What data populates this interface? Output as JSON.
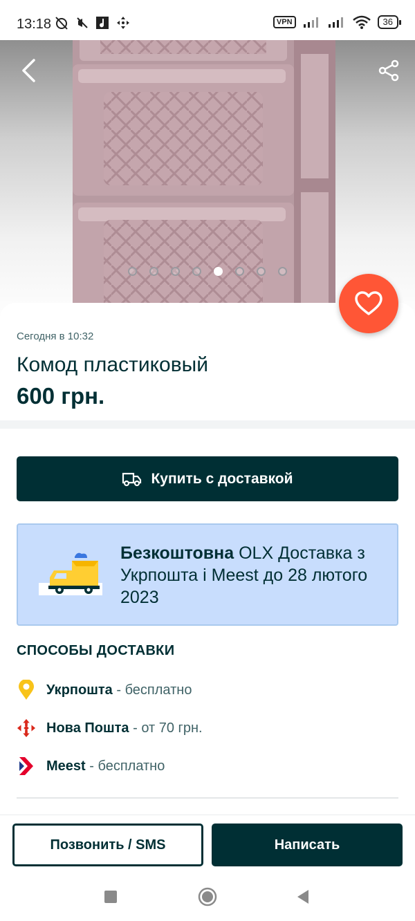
{
  "status_bar": {
    "time": "13:18",
    "vpn": "VPN",
    "battery": "36"
  },
  "gallery": {
    "image_count": 8,
    "active_index": 4
  },
  "listing": {
    "date": "Сегодня в 10:32",
    "title": "Комод пластиковый",
    "price": "600 грн."
  },
  "buy_button": {
    "label": "Купить с доставкой"
  },
  "promo": {
    "bold": "Безкоштовна",
    "text": " OLX Доставка з Укрпошта і Meest до 28 лютого 2023"
  },
  "delivery": {
    "title": "СПОСОБЫ ДОСТАВКИ",
    "methods": [
      {
        "name": "Укрпошта",
        "note": " - бесплатно",
        "icon": "ukrposhta-icon",
        "color": "#f8c31a"
      },
      {
        "name": "Нова Пошта",
        "note": " - от 70 грн.",
        "icon": "nova-poshta-icon",
        "color": "#da291c"
      },
      {
        "name": "Meest",
        "note": " - бесплатно",
        "icon": "meest-icon",
        "color": "#e4002b"
      }
    ]
  },
  "actions": {
    "call": "Позвонить / SMS",
    "write": "Написать"
  },
  "colors": {
    "primary": "#002f34",
    "favorite": "#ff5636",
    "promo_bg": "#c8ddfd"
  }
}
